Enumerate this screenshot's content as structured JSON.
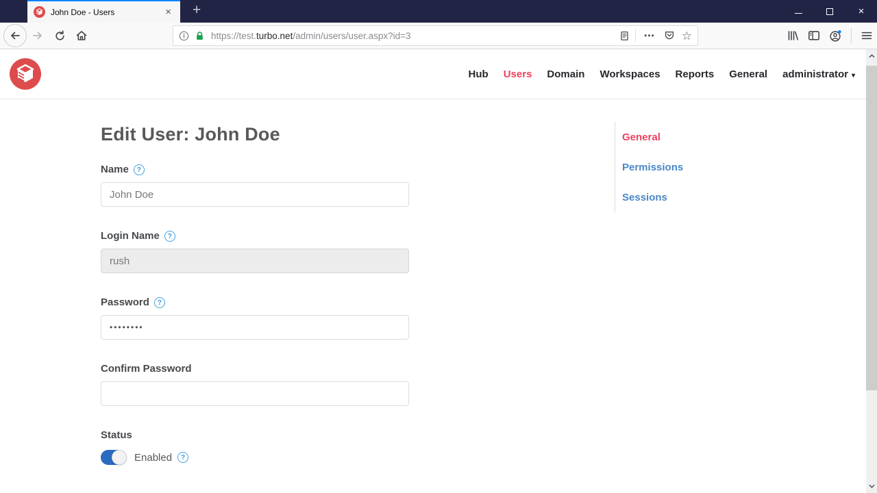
{
  "browser": {
    "tab_title": "John Doe - Users",
    "new_tab_label": "+",
    "tab_close_glyph": "×",
    "window": {
      "close_glyph": "×"
    },
    "url": {
      "scheme_subdomain": "https://test.",
      "domain": "turbo.net",
      "path": "/admin/users/user.aspx?id=3"
    },
    "page_actions_glyph": "•••",
    "bookmark_star_glyph": "☆"
  },
  "site": {
    "nav": [
      {
        "label": "Hub",
        "active": false
      },
      {
        "label": "Users",
        "active": true
      },
      {
        "label": "Domain",
        "active": false
      },
      {
        "label": "Workspaces",
        "active": false
      },
      {
        "label": "Reports",
        "active": false
      },
      {
        "label": "General",
        "active": false
      }
    ],
    "account_menu_label": "administrator",
    "caret_glyph": "▾"
  },
  "page": {
    "title": "Edit User: John Doe",
    "fields": [
      {
        "label": "Name",
        "value": "John Doe",
        "disabled": false,
        "has_help": true
      },
      {
        "label": "Login Name",
        "value": "rush",
        "disabled": true,
        "has_help": true
      },
      {
        "label": "Password",
        "value": "••••••••",
        "disabled": false,
        "has_help": true
      },
      {
        "label": "Confirm Password",
        "value": "",
        "disabled": false,
        "has_help": false
      }
    ],
    "status": {
      "label": "Status",
      "value": "Enabled",
      "enabled": true
    },
    "side_menu": [
      {
        "label": "General",
        "active": true
      },
      {
        "label": "Permissions",
        "active": false
      },
      {
        "label": "Sessions",
        "active": false
      }
    ]
  },
  "icons": {
    "help_glyph": "?"
  },
  "colors": {
    "titlebar": "#212444",
    "tab_accent": "#0a84ff",
    "logo_red": "#de4b4c",
    "active_red": "#ef415e",
    "link_blue": "#4a87c8",
    "toggle_blue": "#2a6bc0",
    "help_blue": "#42a0dc",
    "lock_green": "#16a34a"
  }
}
